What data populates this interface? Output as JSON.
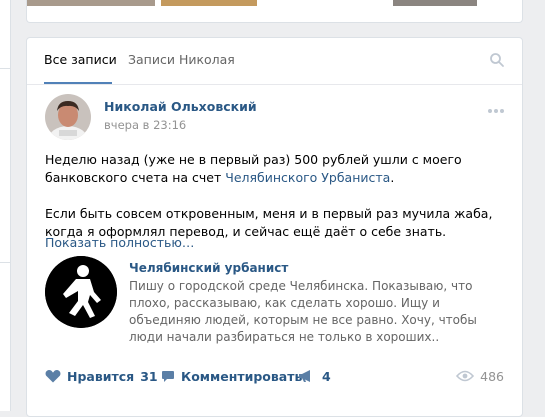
{
  "tabs": {
    "all": "Все записи",
    "owner": "Записи Николая"
  },
  "post": {
    "author": "Николай Ольховский",
    "date": "вчера в 23:16",
    "text_p1_before": "Неделю назад (уже не в первый раз) 500 рублей ушли с моего банковского счета на счет ",
    "text_p1_link": "Челябинского Урбаниста",
    "text_p1_after": ".",
    "text_p2": "Если быть совсем откровенным, меня и в первый раз мучила жаба, когда я оформлял перевод, и сейчас ещё даёт о себе знать.",
    "show_more": "Показать полностью…"
  },
  "attachment": {
    "group_name": "Челябинский урбанист",
    "description": "Пишу о городской среде Челябинска. Показываю, что плохо, рассказываю, как сделать хорошо. Ищу и объединяю людей, которым не все равно. Хочу, чтобы люди начали разбираться не только в хороших.."
  },
  "actions": {
    "like_label": "Нравится",
    "like_count": "31",
    "comment_label": "Комментировать",
    "share_count": "4",
    "views_count": "486"
  },
  "colors": {
    "link": "#2a5885",
    "accent": "#5181b8",
    "icon": "#5b7fa6",
    "muted": "#939393",
    "background": "#edeef0"
  },
  "icons": {
    "search": "search-icon",
    "more": "more-horizontal-icon",
    "like": "heart-icon",
    "comment": "comment-icon",
    "share": "megaphone-icon",
    "views": "eye-icon"
  }
}
